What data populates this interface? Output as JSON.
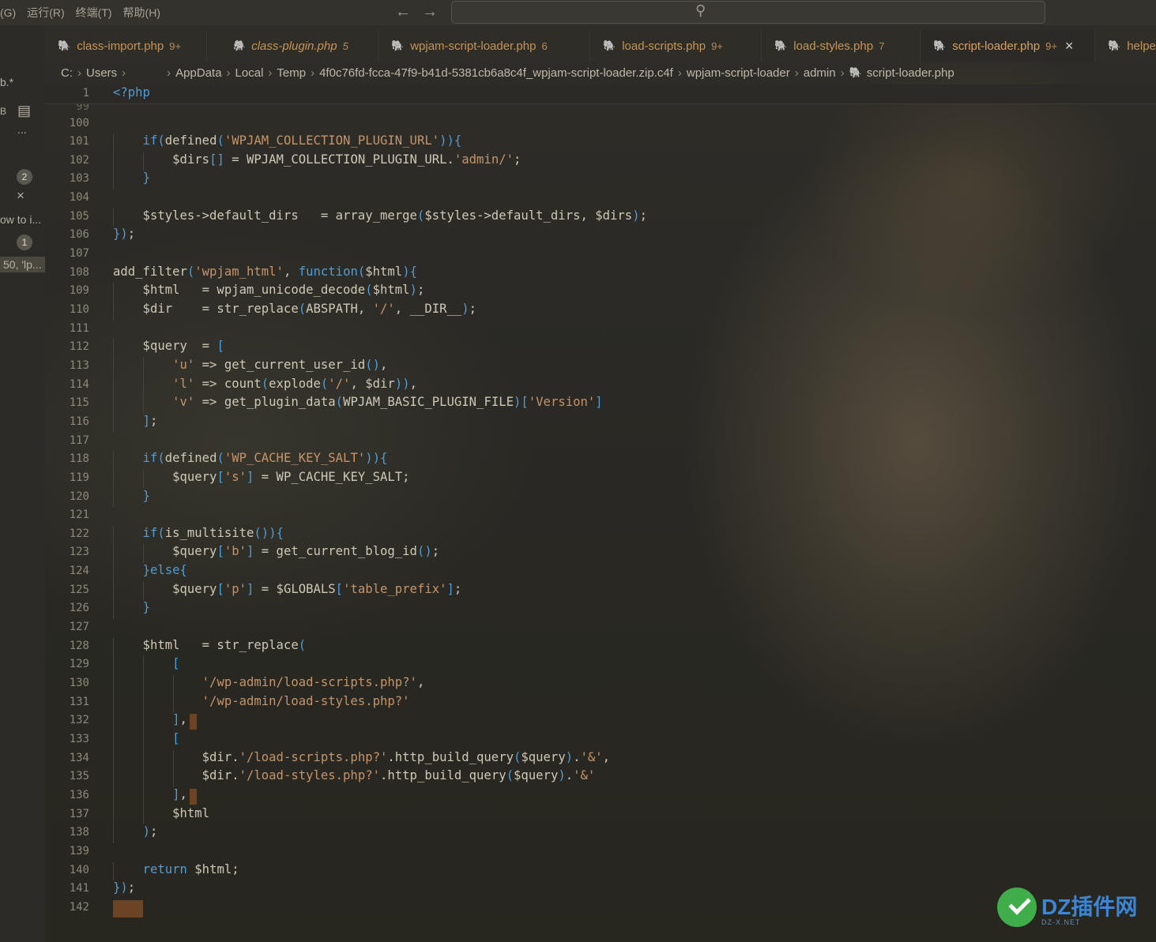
{
  "menu": [
    "(G)",
    "运行(R)",
    "终端(T)",
    "帮助(H)"
  ],
  "activity": {
    "items": [
      "b.*",
      "B",
      "...",
      "ow to i...",
      "50, 'lp..."
    ],
    "badges": [
      "2",
      "1"
    ],
    "close": "×"
  },
  "tabs": [
    {
      "label": "class-import.php",
      "count": "9+"
    },
    {
      "label": "class-plugin.php",
      "count": "5"
    },
    {
      "label": "wpjam-script-loader.php",
      "count": "6"
    },
    {
      "label": "load-scripts.php",
      "count": "9+"
    },
    {
      "label": "load-styles.php",
      "count": "7"
    },
    {
      "label": "script-loader.php",
      "count": "9+",
      "active": true
    },
    {
      "label": "helpe",
      "count": ""
    }
  ],
  "tab_close": "×",
  "breadcrumb": [
    "C:",
    "Users",
    "",
    "AppData",
    "Local",
    "Temp",
    "4f0c76fd-fcca-47f9-b41d-5381cb6a8c4f_wpjam-script-loader.zip.c4f",
    "wpjam-script-loader",
    "admin",
    "script-loader.php"
  ],
  "sticky": {
    "line": "1",
    "code": "<?php",
    "partial_line": "99",
    "partial_code": "    ];"
  },
  "lines": [
    {
      "n": "100",
      "code": ""
    },
    {
      "n": "101",
      "code": "    if(defined('WPJAM_COLLECTION_PLUGIN_URL')){"
    },
    {
      "n": "102",
      "code": "        $dirs[] = WPJAM_COLLECTION_PLUGIN_URL.'admin/';"
    },
    {
      "n": "103",
      "code": "    }"
    },
    {
      "n": "104",
      "code": ""
    },
    {
      "n": "105",
      "code": "    $styles->default_dirs   = array_merge($styles->default_dirs, $dirs);"
    },
    {
      "n": "106",
      "code": "});"
    },
    {
      "n": "107",
      "code": ""
    },
    {
      "n": "108",
      "code": "add_filter('wpjam_html', function($html){"
    },
    {
      "n": "109",
      "code": "    $html   = wpjam_unicode_decode($html);"
    },
    {
      "n": "110",
      "code": "    $dir    = str_replace(ABSPATH, '/', __DIR__);"
    },
    {
      "n": "111",
      "code": ""
    },
    {
      "n": "112",
      "code": "    $query  = ["
    },
    {
      "n": "113",
      "code": "        'u' => get_current_user_id(),"
    },
    {
      "n": "114",
      "code": "        'l' => count(explode('/', $dir)),"
    },
    {
      "n": "115",
      "code": "        'v' => get_plugin_data(WPJAM_BASIC_PLUGIN_FILE)['Version']"
    },
    {
      "n": "116",
      "code": "    ];"
    },
    {
      "n": "117",
      "code": ""
    },
    {
      "n": "118",
      "code": "    if(defined('WP_CACHE_KEY_SALT')){"
    },
    {
      "n": "119",
      "code": "        $query['s'] = WP_CACHE_KEY_SALT;"
    },
    {
      "n": "120",
      "code": "    }"
    },
    {
      "n": "121",
      "code": ""
    },
    {
      "n": "122",
      "code": "    if(is_multisite()){"
    },
    {
      "n": "123",
      "code": "        $query['b'] = get_current_blog_id();"
    },
    {
      "n": "124",
      "code": "    }else{"
    },
    {
      "n": "125",
      "code": "        $query['p'] = $GLOBALS['table_prefix'];"
    },
    {
      "n": "126",
      "code": "    }"
    },
    {
      "n": "127",
      "code": ""
    },
    {
      "n": "128",
      "code": "    $html   = str_replace("
    },
    {
      "n": "129",
      "code": "        ["
    },
    {
      "n": "130",
      "code": "            '/wp-admin/load-scripts.php?',"
    },
    {
      "n": "131",
      "code": "            '/wp-admin/load-styles.php?'"
    },
    {
      "n": "132",
      "code": "        ],"
    },
    {
      "n": "133",
      "code": "        ["
    },
    {
      "n": "134",
      "code": "            $dir.'/load-scripts.php?'.http_build_query($query).'&',"
    },
    {
      "n": "135",
      "code": "            $dir.'/load-styles.php?'.http_build_query($query).'&'"
    },
    {
      "n": "136",
      "code": "        ],"
    },
    {
      "n": "137",
      "code": "        $html"
    },
    {
      "n": "138",
      "code": "    );"
    },
    {
      "n": "139",
      "code": ""
    },
    {
      "n": "140",
      "code": "    return $html;"
    },
    {
      "n": "141",
      "code": "});"
    },
    {
      "n": "142",
      "code": ""
    }
  ],
  "watermark": {
    "text": "DZ插件网",
    "sub": "DZ-X.NET"
  },
  "colors": {
    "keyword": "#4f9cd6",
    "string": "#c5946a",
    "func": "#d9cfa8",
    "variable": "#dcd3bf",
    "accent": "#d7a161"
  }
}
